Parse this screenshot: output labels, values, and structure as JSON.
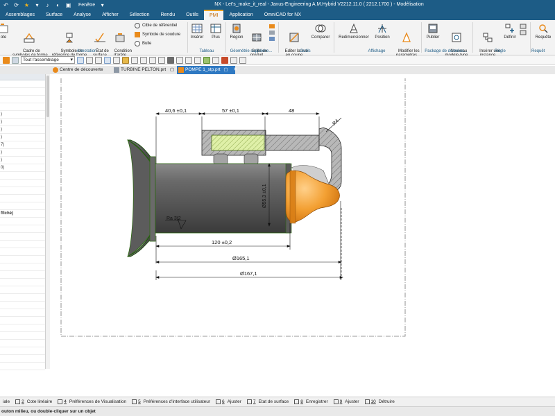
{
  "titlebar": {
    "window_menu": "Fenêtre",
    "title": "NX - Let's_make_it_real - Janus-Engineering A.M.Hybrid V2212.11.0 ( 2212.1700 ) - Modélisation"
  },
  "menu_tabs": [
    {
      "label": "Assemblages"
    },
    {
      "label": "Surface"
    },
    {
      "label": "Analyse"
    },
    {
      "label": "Afficher"
    },
    {
      "label": "Sélection"
    },
    {
      "label": "Rendu"
    },
    {
      "label": "Outils"
    },
    {
      "label": "PMI"
    },
    {
      "label": "Application"
    },
    {
      "label": "OmniCAD for NX"
    }
  ],
  "active_tab": "PMI",
  "ribbon": {
    "annotation": {
      "note": "ote",
      "cadre": "Cadre de\nsymboles de forme",
      "symbole_ref": "Symbole de\nréférence de forme",
      "etat_surface": "État de\nsurface",
      "condition_arete": "Condition\nd'arête",
      "cible": "Cible de référentiel",
      "soudure": "Symbole de soudure",
      "bulle": "Bulle",
      "group": "Annotation"
    },
    "tableau": {
      "inserer": "Insérer",
      "plus": "Plus",
      "group": "Tableau"
    },
    "geometrie": {
      "region": "Région",
      "grille": "Grille de\nproduit",
      "group": "Géométrie suppléme..."
    },
    "outils": {
      "editer": "Editer la vue\nen coupe",
      "comparer": "Comparer",
      "group": "Outils"
    },
    "affichage": {
      "redim": "Redimensionner",
      "position": "Position",
      "modifier": "Modifier les\nparamètres",
      "group": "Affichage"
    },
    "package": {
      "publier": "Publier",
      "nouveau": "Nouveau\nmodèle-type",
      "group": "Package de données..."
    },
    "regle": {
      "inserer_instance": "Insérer une\ninstance",
      "definir": "Définir",
      "group": "Règle"
    },
    "requete": {
      "requete": "Requête",
      "group": "Requêt"
    }
  },
  "toolbar2": {
    "assembly_filter": "Tout l'assemblage"
  },
  "doc_tabs": [
    {
      "label": "Centre de découverte"
    },
    {
      "label": "TURBINE PELTON.prt"
    },
    {
      "label": "POMPE 1_stp.prt"
    }
  ],
  "left_panel": {
    "rows": [
      "",
      "",
      "",
      "",
      ")",
      ")",
      ")",
      ")",
      "7)",
      ")",
      ")",
      "0)",
      "",
      "",
      "",
      "",
      "",
      "ffiché)",
      "",
      "",
      "",
      "",
      "",
      "",
      "",
      "",
      "",
      "",
      "",
      "",
      "",
      "",
      "",
      "",
      "",
      "",
      "",
      ""
    ]
  },
  "drawing": {
    "dim_top_left": "40,6 ±0,1",
    "dim_top_mid": "57 ±0,1",
    "dim_top_right": "48",
    "radius": "R4",
    "dia_vertical": "Ø55,3 ±0,1",
    "roughness": "Ra 3,2",
    "dim_120": "120 ±0,2",
    "dim_165": "Ø165,1",
    "dim_167": "Ø167,1"
  },
  "statusbar": [
    {
      "num": "",
      "label": "iale"
    },
    {
      "num": "2",
      "label": "Cote linéaire"
    },
    {
      "num": "4",
      "label": "Préférences de Visualisation"
    },
    {
      "num": "5",
      "label": "Préférences d'interface utilisateur"
    },
    {
      "num": "6",
      "label": "Ajuster"
    },
    {
      "num": "7",
      "label": "Etat de surface"
    },
    {
      "num": "8",
      "label": "Enregistrer"
    },
    {
      "num": "9",
      "label": "Ajuster"
    },
    {
      "num": "10",
      "label": "Détruire"
    }
  ],
  "cue": "outon milieu, ou double-cliquer sur un objet",
  "colors": {
    "brand": "#1d5c86",
    "accent_tab": "#e7a126",
    "active_doc": "#2f79c2",
    "orange_part": "#e98a1b",
    "shaft_gray": "#5a5a5a",
    "hatch_green": "#d7ec9a"
  }
}
